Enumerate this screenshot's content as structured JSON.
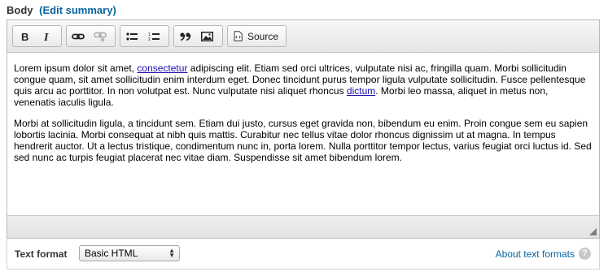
{
  "field": {
    "label": "Body",
    "summary_open": "(",
    "summary_link": "Edit summary",
    "summary_close": ")"
  },
  "toolbar": {
    "bold_icon": "bold-icon",
    "italic_icon": "italic-icon",
    "link_icon": "link-icon",
    "unlink_icon": "unlink-icon",
    "bulleted_list_icon": "bulleted-list-icon",
    "numbered_list_icon": "numbered-list-icon",
    "blockquote_icon": "blockquote-icon",
    "image_icon": "image-icon",
    "source_label": "Source"
  },
  "content": {
    "p1_a": "Lorem ipsum dolor sit amet, ",
    "p1_link": "consectetur",
    "p1_b": " adipiscing elit. Etiam sed orci ultrices, vulputate nisi ac, fringilla quam. Morbi sollicitudin congue quam, sit amet sollicitudin enim interdum eget. Donec tincidunt purus tempor ligula vulputate sollicitudin. Fusce pellentesque quis arcu ac porttitor. In non volutpat est. Nunc vulputate nisi aliquet rhoncus ",
    "p1_link2": "dictum",
    "p1_c": ". Morbi leo massa, aliquet in metus non, venenatis iaculis ligula.",
    "p2": "Morbi at sollicitudin ligula, a tincidunt sem. Etiam dui justo, cursus eget gravida non, bibendum eu enim. Proin congue sem eu sapien lobortis lacinia. Morbi consequat at nibh quis mattis. Curabitur nec tellus vitae dolor rhoncus dignissim ut at magna. In tempus hendrerit auctor. Ut a lectus tristique, condimentum nunc in, porta lorem. Nulla porttitor tempor lectus, varius feugiat orci luctus id. Sed sed nunc ac turpis feugiat placerat nec vitae diam. Suspendisse sit amet bibendum lorem."
  },
  "format": {
    "label": "Text format",
    "selected": "Basic HTML",
    "about_link": "About text formats",
    "help_glyph": "?"
  }
}
